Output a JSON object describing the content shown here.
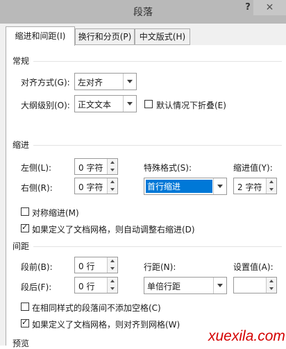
{
  "window": {
    "title": "段落",
    "help": "?",
    "close": "✕"
  },
  "tabs": [
    "缩进和间距(I)",
    "换行和分页(P)",
    "中文版式(H)"
  ],
  "general": {
    "heading": "常规",
    "alignment_label": "对齐方式(G):",
    "alignment_value": "左对齐",
    "outline_label": "大纲级别(O):",
    "outline_value": "正文文本",
    "collapse_label": "默认情况下折叠(E)",
    "collapse_checked": false
  },
  "indent": {
    "heading": "缩进",
    "left_label": "左侧(L):",
    "left_value": "0 字符",
    "right_label": "右侧(R):",
    "right_value": "0 字符",
    "special_label": "特殊格式(S):",
    "special_value": "首行缩进",
    "by_label": "缩进值(Y):",
    "by_value": "2 字符",
    "mirror_label": "对称缩进(M)",
    "mirror_checked": false,
    "grid_label": "如果定义了文档网格，则自动调整右缩进(D)",
    "grid_checked": true
  },
  "spacing": {
    "heading": "间距",
    "before_label": "段前(B):",
    "before_value": "0 行",
    "after_label": "段后(F):",
    "after_value": "0 行",
    "line_label": "行距(N):",
    "line_value": "单倍行距",
    "at_label": "设置值(A):",
    "at_value": "",
    "nospace_label": "在相同样式的段落间不添加空格(C)",
    "nospace_checked": false,
    "snap_label": "如果定义了文档网格，则对齐到网格(W)",
    "snap_checked": true
  },
  "preview": {
    "heading": "预览"
  },
  "watermark": "xuexila.com"
}
